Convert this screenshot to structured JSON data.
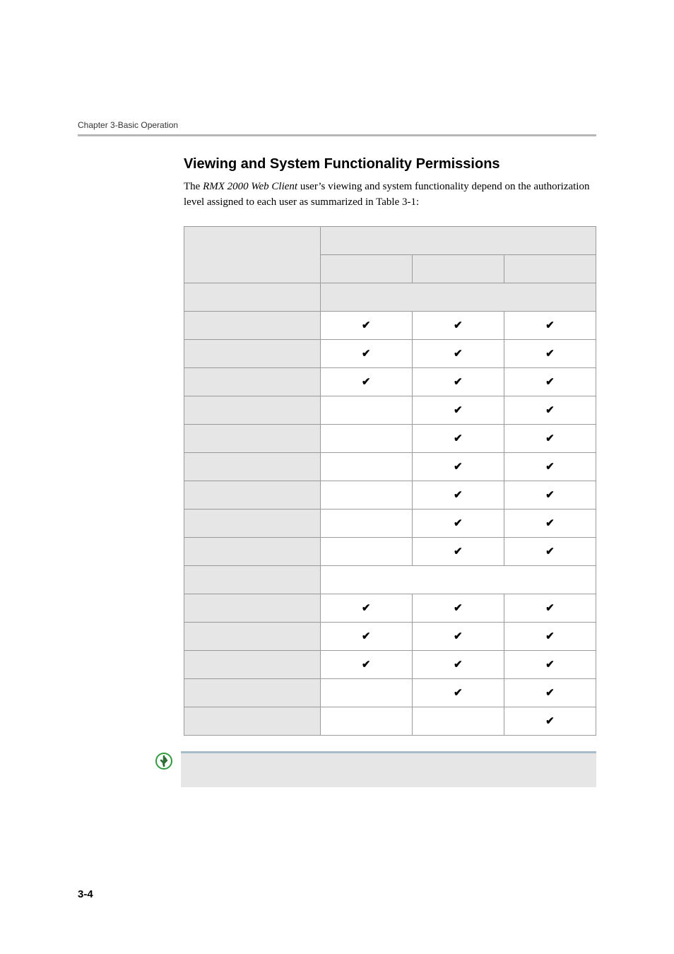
{
  "chapterLine": "Chapter 3-Basic Operation",
  "sectionHeading": "Viewing and System Functionality Permissions",
  "bodyText": {
    "pre": "The ",
    "em": "RMX 2000 Web Client",
    "post": " user’s viewing and system functionality depend on the authorization level assigned to each user as summarized in Table 3-1:"
  },
  "check": "✔",
  "tableHeader": {
    "top": "",
    "c1": "",
    "c2": "",
    "c3": ""
  },
  "section1Label": "",
  "rows1": [
    {
      "label": "",
      "cells": [
        true,
        true,
        true
      ]
    },
    {
      "label": "",
      "cells": [
        true,
        true,
        true
      ]
    },
    {
      "label": "",
      "cells": [
        true,
        true,
        true
      ]
    },
    {
      "label": "",
      "cells": [
        false,
        true,
        true
      ]
    },
    {
      "label": "",
      "cells": [
        false,
        true,
        true
      ]
    },
    {
      "label": "",
      "cells": [
        false,
        true,
        true
      ]
    },
    {
      "label": "",
      "cells": [
        false,
        true,
        true
      ]
    },
    {
      "label": "",
      "cells": [
        false,
        true,
        true
      ]
    },
    {
      "label": "",
      "cells": [
        false,
        true,
        true
      ]
    }
  ],
  "section2Label": "",
  "rows2": [
    {
      "label": "",
      "cells": [
        true,
        true,
        true
      ]
    },
    {
      "label": "",
      "cells": [
        true,
        true,
        true
      ]
    },
    {
      "label": "",
      "cells": [
        true,
        true,
        true
      ]
    },
    {
      "label": "",
      "cells": [
        false,
        true,
        true
      ]
    },
    {
      "label": "",
      "cells": [
        false,
        false,
        true
      ]
    }
  ],
  "infoText": "",
  "pageNumber": "3-4"
}
